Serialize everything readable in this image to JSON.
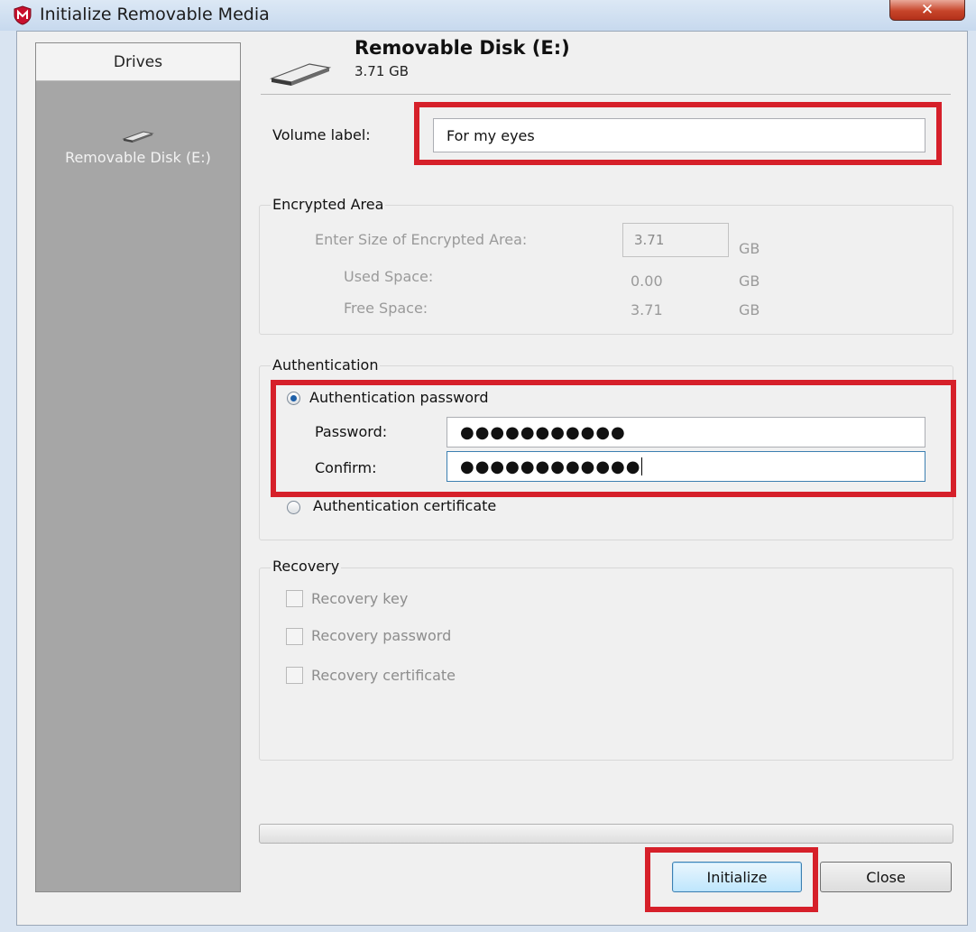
{
  "window": {
    "title": "Initialize Removable Media",
    "close_glyph": "✕"
  },
  "sidebar": {
    "header": "Drives",
    "drive_label": "Removable Disk (E:)"
  },
  "disk": {
    "title": "Removable Disk (E:)",
    "size": "3.71 GB"
  },
  "volume": {
    "label": "Volume label:",
    "value": "For my eyes"
  },
  "encrypted_area": {
    "legend": "Encrypted Area",
    "enter_size_label": "Enter Size of Encrypted Area:",
    "enter_size_value": "3.71",
    "enter_size_unit": "GB",
    "used_label": "Used Space:",
    "used_value": "0.00",
    "used_unit": "GB",
    "free_label": "Free Space:",
    "free_value": "3.71",
    "free_unit": "GB"
  },
  "authentication": {
    "legend": "Authentication",
    "password_option": "Authentication password",
    "password_label": "Password:",
    "password_value": "●●●●●●●●●●●",
    "confirm_label": "Confirm:",
    "confirm_value": "●●●●●●●●●●●●",
    "certificate_option": "Authentication certificate"
  },
  "recovery": {
    "legend": "Recovery",
    "key": "Recovery key",
    "password": "Recovery password",
    "certificate": "Recovery certificate"
  },
  "buttons": {
    "initialize": "Initialize",
    "close": "Close"
  },
  "colors": {
    "highlight": "#d6202a",
    "sidebar": "#a6a6a6",
    "radio_selected": "#1d5fa8"
  }
}
